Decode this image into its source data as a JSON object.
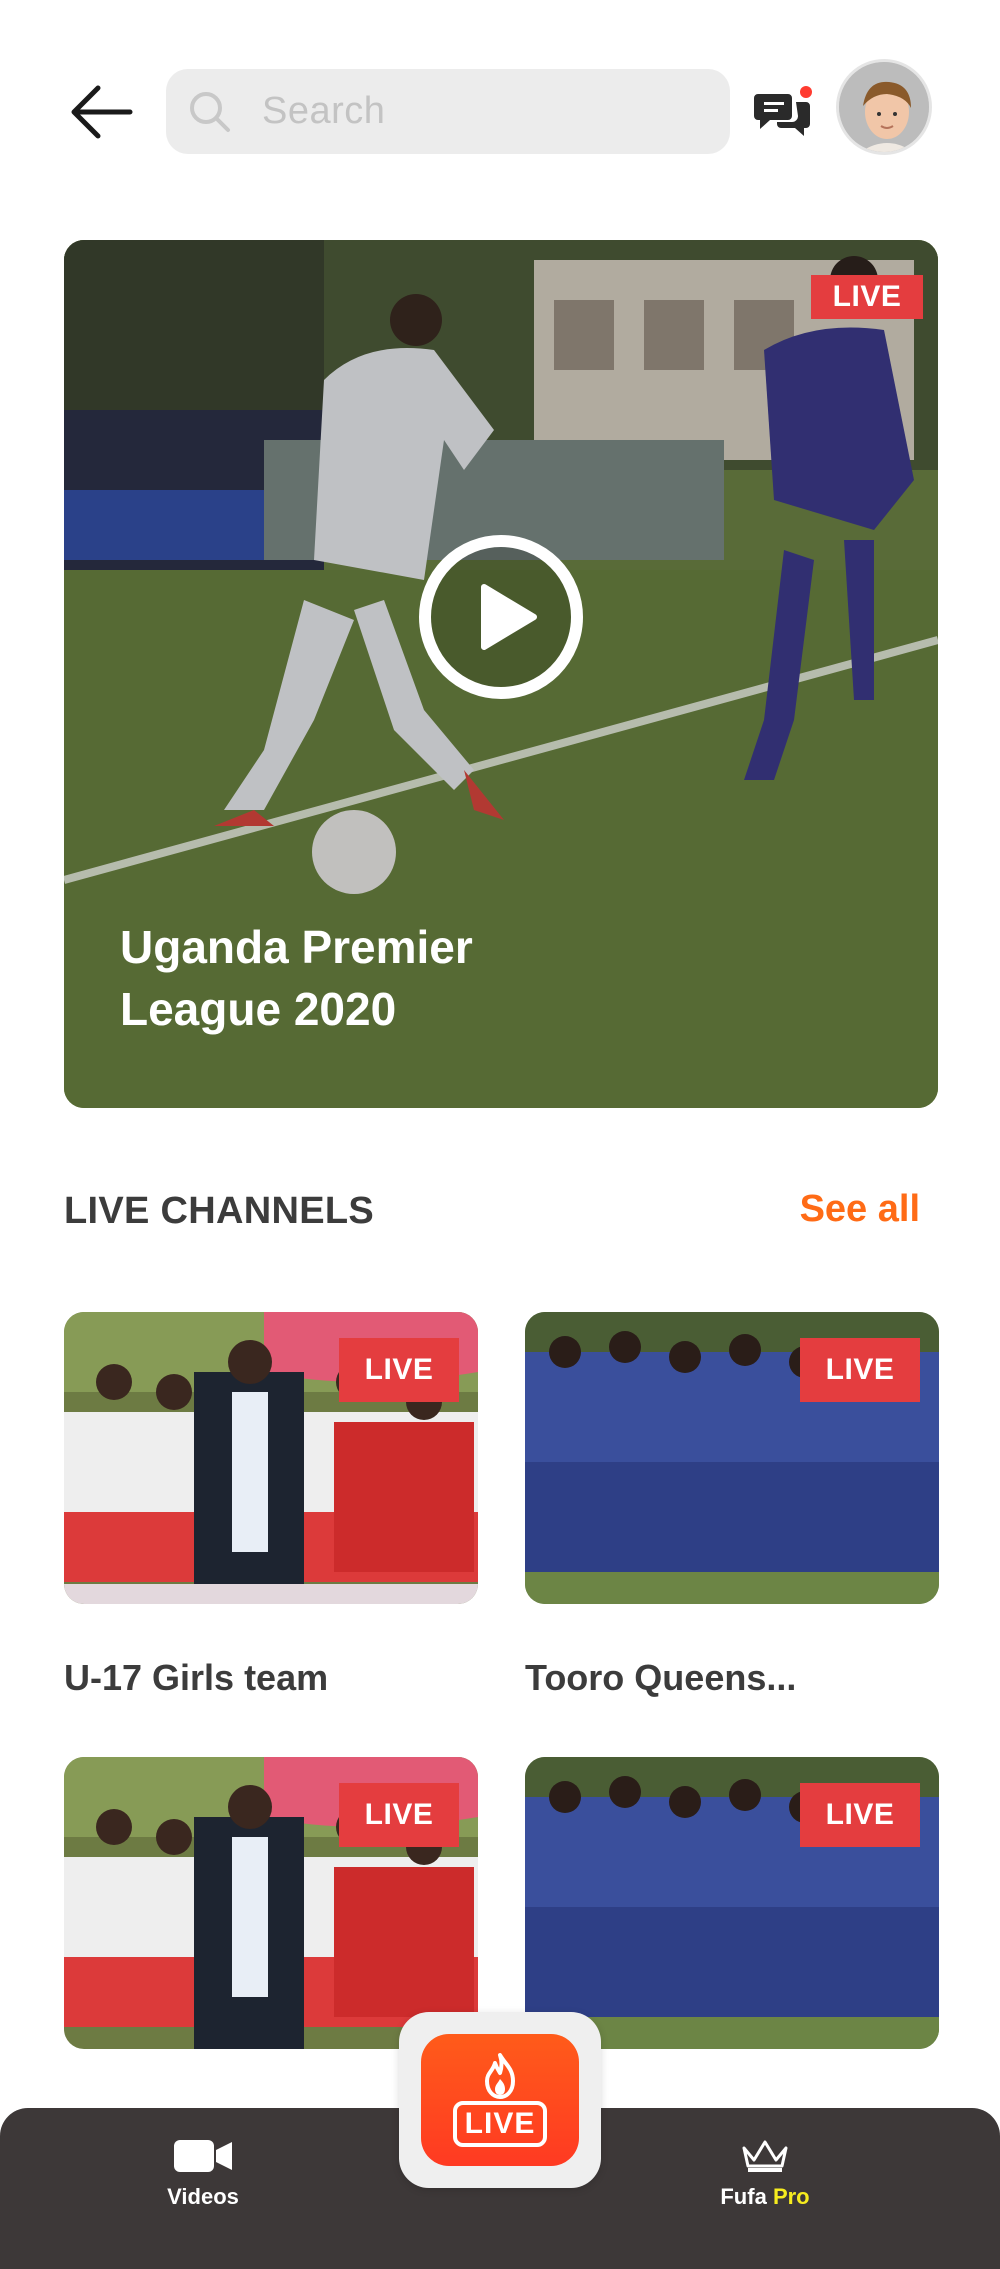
{
  "header": {
    "search_placeholder": "Search",
    "icons": [
      "back-arrow-icon",
      "search-icon",
      "messages-icon",
      "avatar"
    ]
  },
  "hero": {
    "badge": "LIVE",
    "title": "Uganda Premier League 2020",
    "icon": "play-icon"
  },
  "section": {
    "title": "LIVE CHANNELS",
    "see_all": "See all"
  },
  "channels": [
    {
      "badge": "LIVE",
      "label": "U-17 Girls team"
    },
    {
      "badge": "LIVE",
      "label": "Tooro Queens..."
    },
    {
      "badge": "LIVE",
      "label": ""
    },
    {
      "badge": "LIVE",
      "label": ""
    }
  ],
  "nav": {
    "videos_label": "Videos",
    "pro_label_1": "Fufa",
    "pro_label_2": "Pro",
    "live_label": "LIVE"
  },
  "colors": {
    "accent": "#ff6b16",
    "live_badge": "#e43d3f",
    "nav_bg": "#3d3838",
    "pro_yellow": "#f6ec1f"
  }
}
